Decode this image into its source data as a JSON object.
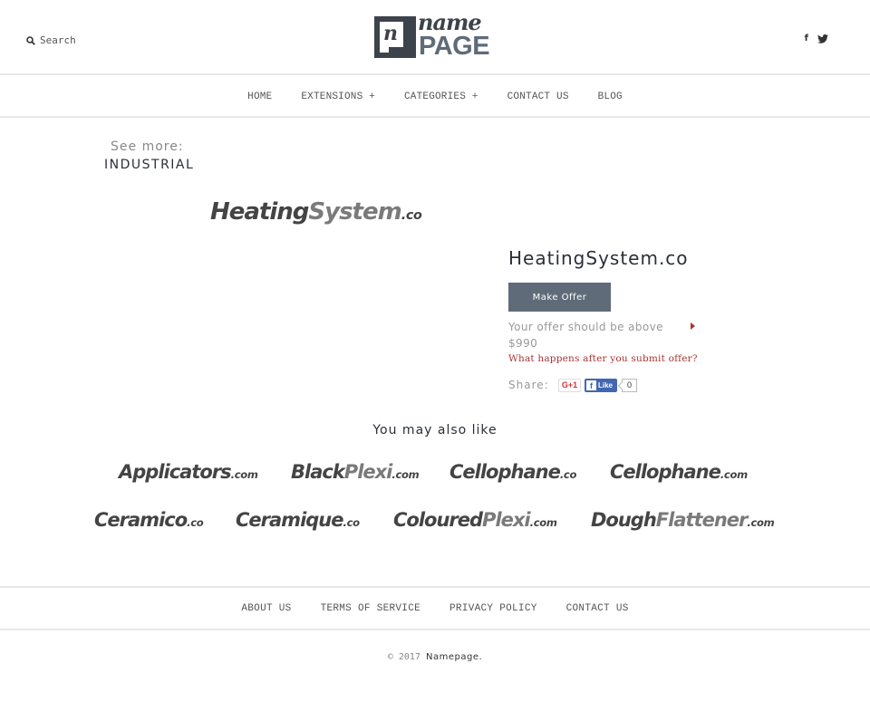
{
  "header": {
    "search_label": "Search",
    "logo": {
      "letter": "n",
      "top": "name",
      "bottom": "PAGE"
    },
    "social": {
      "facebook": "f",
      "twitter": "twitter"
    }
  },
  "nav": {
    "items": [
      {
        "label": "HOME"
      },
      {
        "label": "EXTENSIONS +"
      },
      {
        "label": "CATEGORIES +"
      },
      {
        "label": "CONTACT US"
      },
      {
        "label": "BLOG"
      }
    ]
  },
  "sidebar": {
    "see_more": "See more:",
    "category": "INDUSTRIAL"
  },
  "product": {
    "logo": {
      "part1": "Heating",
      "part2": "System",
      "tld": ".co"
    },
    "title": "HeatingSystem.co",
    "offer_button": "Make Offer",
    "offer_note": "Your offer should be above $990",
    "help_link": "What happens after you submit offer?",
    "share_label": "Share:",
    "gplus_label": "G+1",
    "fb_like_label": "Like",
    "fb_count": "0"
  },
  "related": {
    "heading": "You may also like",
    "items": [
      {
        "part1": "Applicators",
        "part2": "",
        "tld": ".com"
      },
      {
        "part1": "Black",
        "part2": "Plexi",
        "tld": ".com"
      },
      {
        "part1": "Cellophane",
        "part2": "",
        "tld": ".co"
      },
      {
        "part1": "Cellophane",
        "part2": "",
        "tld": ".com"
      },
      {
        "part1": "Ceramico",
        "part2": "",
        "tld": ".co"
      },
      {
        "part1": "Ceramique",
        "part2": "",
        "tld": ".co"
      },
      {
        "part1": "Coloured",
        "part2": "Plexi",
        "tld": ".com"
      },
      {
        "part1": "Dough",
        "part2": "Flattener",
        "tld": ".com"
      }
    ]
  },
  "footer": {
    "links": [
      {
        "label": "ABOUT US"
      },
      {
        "label": "TERMS OF SERVICE"
      },
      {
        "label": "PRIVACY POLICY"
      },
      {
        "label": "CONTACT US"
      }
    ],
    "copyright_prefix": "© 2017",
    "copyright_brand": "Namepage."
  }
}
